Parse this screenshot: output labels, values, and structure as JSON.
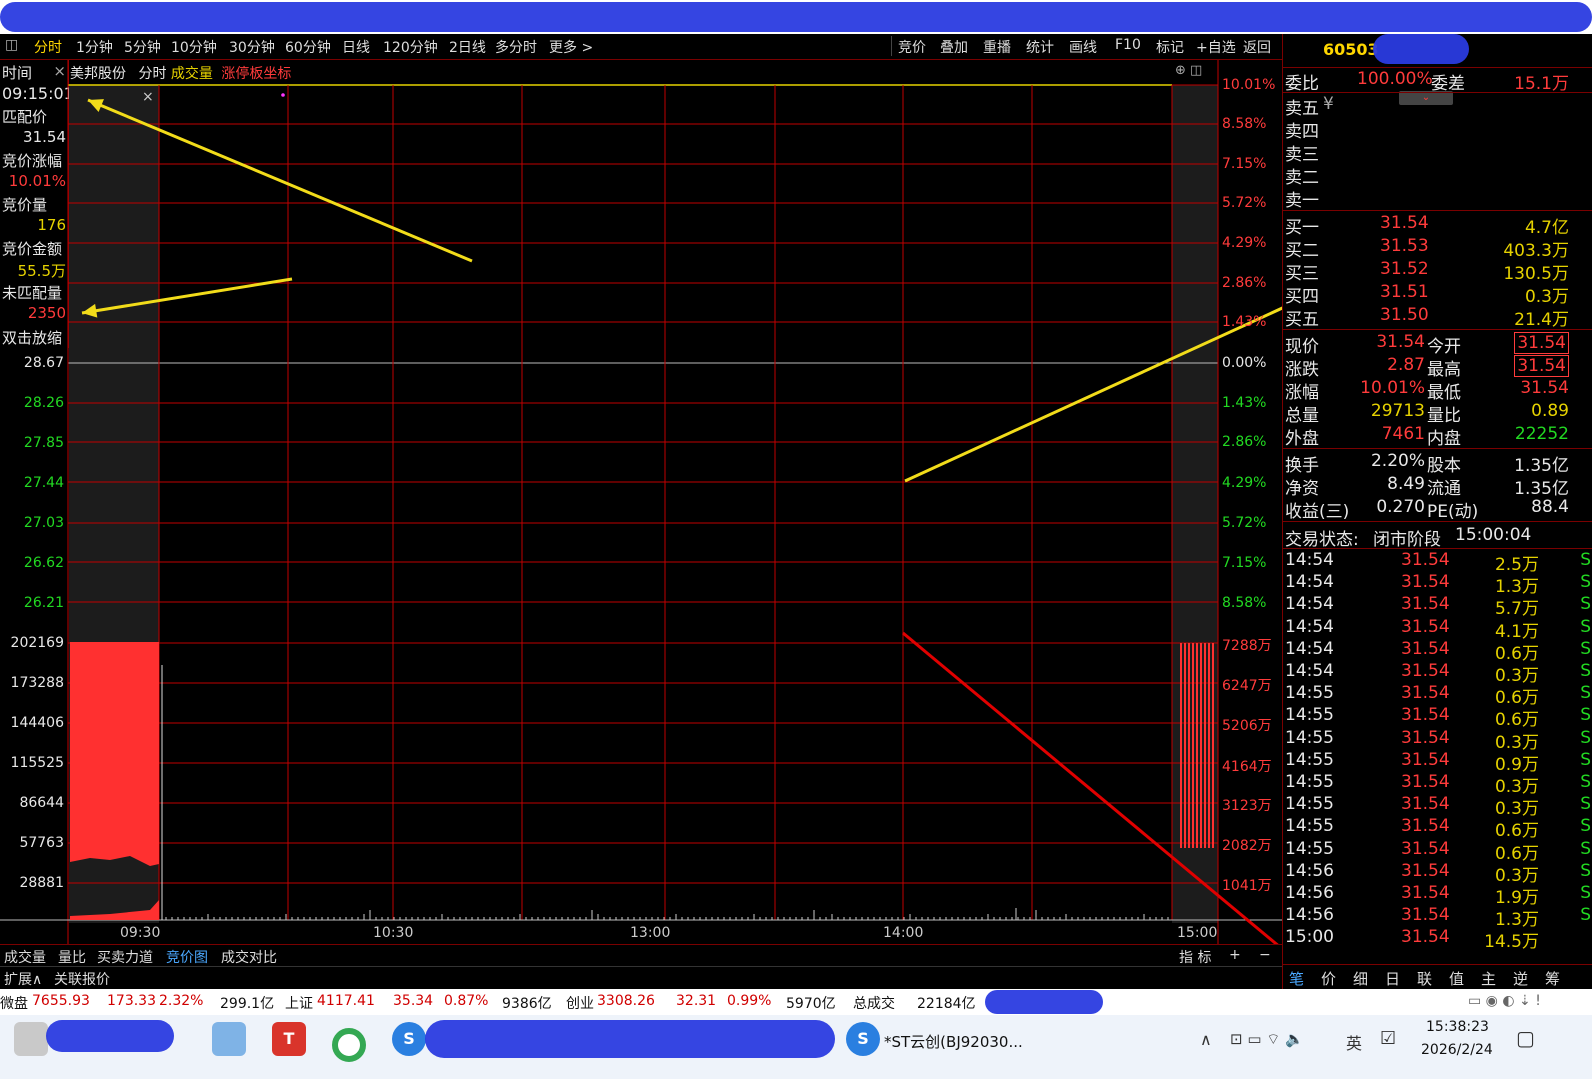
{
  "tabs": [
    "分时",
    "1分钟",
    "5分钟",
    "10分钟",
    "30分钟",
    "60分钟",
    "日线",
    "120分钟",
    "2日线",
    "多分时",
    "更多 >"
  ],
  "tools": [
    "竞价",
    "叠加",
    "重播",
    "统计",
    "画线",
    "F10",
    "标记",
    "+自选",
    "返回"
  ],
  "chart_header": {
    "stock_name": "美邦股份",
    "mode": "分时",
    "vol_label": "成交量",
    "limit_label": "涨停板坐标"
  },
  "info_panel": {
    "time_label": "时间",
    "time_value": "09:15:01",
    "match_price_label": "匹配价",
    "match_price": "31.54",
    "auction_pct_label": "竞价涨幅",
    "auction_pct": "10.01%",
    "auction_vol_label": "竞价量",
    "auction_vol": "176",
    "auction_amt_label": "竞价金额",
    "auction_amt": "55.5万",
    "unmatched_label": "未匹配量",
    "unmatched": "2350",
    "dblclick_label": "双击放缩"
  },
  "price_axis_left": [
    "28.67",
    "28.26",
    "27.85",
    "27.44",
    "27.03",
    "26.62",
    "26.21"
  ],
  "vol_axis_left": [
    "202169",
    "173288",
    "144406",
    "115525",
    "86644",
    "57763",
    "28881"
  ],
  "pct_axis_upper": [
    "10.01%",
    "8.58%",
    "7.15%",
    "5.72%",
    "4.29%",
    "2.86%",
    "1.43%"
  ],
  "pct_axis_lower": [
    "0.00%",
    "1.43%",
    "2.86%",
    "4.29%",
    "5.72%",
    "7.15%",
    "8.58%"
  ],
  "vol_axis_right": [
    "7288万",
    "6247万",
    "5206万",
    "4164万",
    "3123万",
    "2082万",
    "1041万"
  ],
  "time_axis": [
    "09:30",
    "10:30",
    "13:00",
    "14:00",
    "15:00"
  ],
  "bottom_tabs": [
    "成交量",
    "量比",
    "买卖力道",
    "竞价图",
    "成交对比"
  ],
  "bottom_right": [
    "指 标",
    "+",
    "−"
  ],
  "ext_tabs": [
    "扩展∧",
    "关联报价"
  ],
  "quote": {
    "code": "60503",
    "weibi_label": "委比",
    "weibi": "100.00%",
    "weicha_label": "委差",
    "weicha": "15.1万",
    "sell": [
      "卖五",
      "卖四",
      "卖三",
      "卖二",
      "卖一"
    ],
    "buy": [
      {
        "label": "买一",
        "price": "31.54",
        "vol": "4.7亿"
      },
      {
        "label": "买二",
        "price": "31.53",
        "vol": "403.3万"
      },
      {
        "label": "买三",
        "price": "31.52",
        "vol": "130.5万"
      },
      {
        "label": "买四",
        "price": "31.51",
        "vol": "0.3万"
      },
      {
        "label": "买五",
        "price": "31.50",
        "vol": "21.4万"
      }
    ],
    "stats1": [
      {
        "l1": "现价",
        "v1": "31.54",
        "l2": "今开",
        "v2": "31.54"
      },
      {
        "l1": "涨跌",
        "v1": "2.87",
        "l2": "最高",
        "v2": "31.54"
      },
      {
        "l1": "涨幅",
        "v1": "10.01%",
        "l2": "最低",
        "v2": "31.54"
      },
      {
        "l1": "总量",
        "v1": "29713",
        "l2": "量比",
        "v2": "0.89"
      },
      {
        "l1": "外盘",
        "v1": "7461",
        "l2": "内盘",
        "v2": "22252"
      }
    ],
    "stats2": [
      {
        "l1": "换手",
        "v1": "2.20%",
        "l2": "股本",
        "v2": "1.35亿"
      },
      {
        "l1": "净资",
        "v1": "8.49",
        "l2": "流通",
        "v2": "1.35亿"
      },
      {
        "l1": "收益(三)",
        "v1": "0.270",
        "l2": "PE(动)",
        "v2": "88.4"
      }
    ],
    "status_label": "交易状态:",
    "status_value": "闭市阶段",
    "status_time": "15:00:04",
    "ticks": [
      {
        "t": "14:54",
        "p": "31.54",
        "v": "2.5万",
        "s": "S"
      },
      {
        "t": "14:54",
        "p": "31.54",
        "v": "1.3万",
        "s": "S"
      },
      {
        "t": "14:54",
        "p": "31.54",
        "v": "5.7万",
        "s": "S"
      },
      {
        "t": "14:54",
        "p": "31.54",
        "v": "4.1万",
        "s": "S"
      },
      {
        "t": "14:54",
        "p": "31.54",
        "v": "0.6万",
        "s": "S"
      },
      {
        "t": "14:54",
        "p": "31.54",
        "v": "0.3万",
        "s": "S"
      },
      {
        "t": "14:55",
        "p": "31.54",
        "v": "0.6万",
        "s": "S"
      },
      {
        "t": "14:55",
        "p": "31.54",
        "v": "0.6万",
        "s": "S"
      },
      {
        "t": "14:55",
        "p": "31.54",
        "v": "0.3万",
        "s": "S"
      },
      {
        "t": "14:55",
        "p": "31.54",
        "v": "0.9万",
        "s": "S"
      },
      {
        "t": "14:55",
        "p": "31.54",
        "v": "0.3万",
        "s": "S"
      },
      {
        "t": "14:55",
        "p": "31.54",
        "v": "0.3万",
        "s": "S"
      },
      {
        "t": "14:55",
        "p": "31.54",
        "v": "0.6万",
        "s": "S"
      },
      {
        "t": "14:55",
        "p": "31.54",
        "v": "0.6万",
        "s": "S"
      },
      {
        "t": "14:56",
        "p": "31.54",
        "v": "0.3万",
        "s": "S"
      },
      {
        "t": "14:56",
        "p": "31.54",
        "v": "1.9万",
        "s": "S"
      },
      {
        "t": "14:56",
        "p": "31.54",
        "v": "1.3万",
        "s": "S"
      },
      {
        "t": "15:00",
        "p": "31.54",
        "v": "14.5万",
        "s": ""
      }
    ],
    "bottom_tabs": [
      "笔",
      "价",
      "细",
      "日",
      "联",
      "值",
      "主",
      "逆",
      "筹"
    ]
  },
  "statusbar": {
    "a_name": "微盘",
    "a_val": "7655.93",
    "a_chg": "173.33",
    "a_pct": "2.32%",
    "a_amt": "299.1亿",
    "b_name": "上证",
    "b_val": "4117.41",
    "b_chg": "35.34",
    "b_pct": "0.87%",
    "b_amt": "9386亿",
    "c_name": "创业",
    "c_val": "3308.26",
    "c_chg": "32.31",
    "c_pct": "0.99%",
    "c_amt": "5970亿",
    "d_name": "总成交",
    "d_val": "22184亿"
  },
  "taskbar": {
    "window_title": "*ST云创(BJ92030...",
    "clock": "15:38:23",
    "date": "2026/2/24",
    "ime": "英"
  },
  "colors": {
    "grid": "#c00000",
    "volume": "#ff3030",
    "annotation_yellow": "#f2dc1a",
    "annotation_red": "#e00000"
  }
}
